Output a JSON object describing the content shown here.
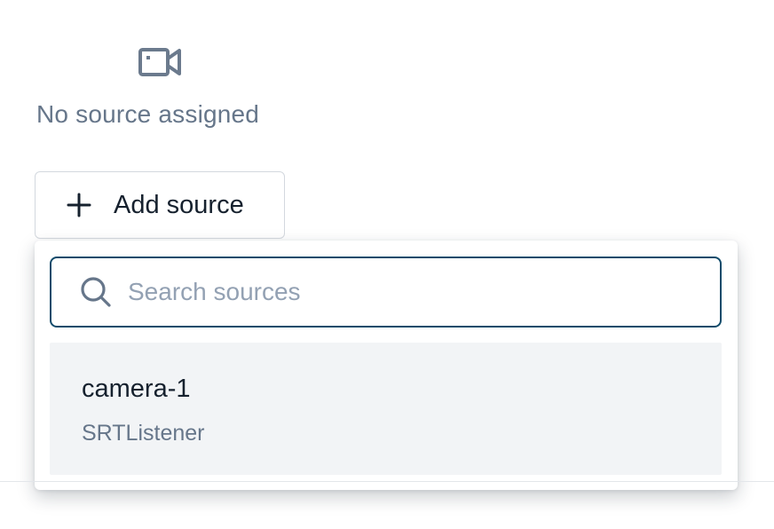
{
  "empty_state": {
    "icon": "video-camera-icon",
    "message": "No source assigned"
  },
  "add_button": {
    "icon": "plus-icon",
    "label": "Add source"
  },
  "dropdown": {
    "search": {
      "icon": "search-icon",
      "placeholder": "Search sources",
      "value": ""
    },
    "items": [
      {
        "name": "camera-1",
        "type": "SRTListener"
      }
    ]
  },
  "colors": {
    "focus_border": "#0f4b6b",
    "muted_text": "#66768a",
    "item_hover_bg": "#f2f4f6"
  }
}
